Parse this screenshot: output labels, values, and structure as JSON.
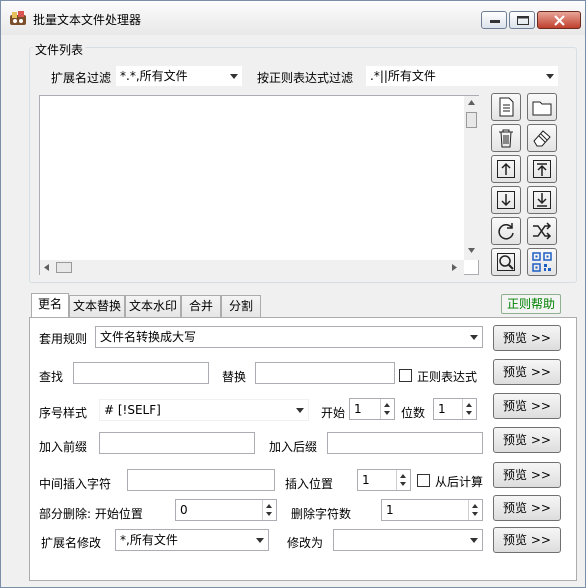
{
  "window": {
    "title": "批量文本文件处理器"
  },
  "file_list": {
    "legend": "文件列表",
    "ext_filter_label": "扩展名过滤",
    "ext_filter_value": "*.*,所有文件",
    "regex_filter_label": "按正则表达式过滤",
    "regex_filter_value": ".*||所有文件"
  },
  "tabs": [
    {
      "label": "更名"
    },
    {
      "label": "文本替换"
    },
    {
      "label": "文本水印"
    },
    {
      "label": "合并"
    },
    {
      "label": "分割"
    }
  ],
  "regex_help_label": "正则帮助",
  "rename": {
    "rule_label": "套用规则",
    "rule_value": "文件名转换成大写",
    "find_label": "查找",
    "find_value": "",
    "replace_label": "替换",
    "replace_value": "",
    "regex_label": "正则表达式",
    "seq_style_label": "序号样式",
    "seq_style_value": "# [!SELF]",
    "start_label": "开始",
    "start_value": "1",
    "digits_label": "位数",
    "digits_value": "1",
    "prefix_label": "加入前缀",
    "prefix_value": "",
    "suffix_label": "加入后缀",
    "suffix_value": "",
    "mid_insert_label": "中间插入字符",
    "mid_insert_value": "",
    "insert_pos_label": "插入位置",
    "insert_pos_value": "1",
    "from_end_label": "从后计算",
    "partial_delete_label": "部分删除: 开始位置",
    "partial_delete_value": "0",
    "delete_count_label": "删除字符数",
    "delete_count_value": "1",
    "ext_change_label": "扩展名修改",
    "ext_change_value": "*,所有文件",
    "change_to_label": "修改为",
    "change_to_value": "",
    "preview_label": "预览 >>"
  },
  "colors": {
    "help_text": "#008000",
    "accent": "#1e5fc4"
  }
}
